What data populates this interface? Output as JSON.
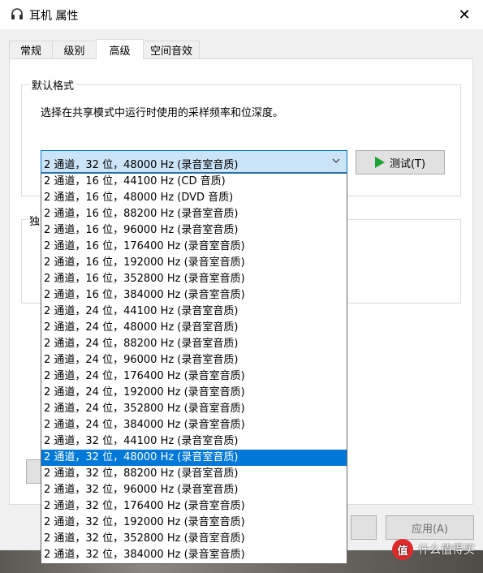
{
  "window": {
    "title": "耳机 属性",
    "close_symbol": "✕"
  },
  "tabs": [
    "常规",
    "级别",
    "高级",
    "空间音效"
  ],
  "default_format": {
    "legend": "默认格式",
    "description": "选择在共享模式中运行时使用的采样频率和位深度。",
    "selected": "2 通道，32 位，48000 Hz (录音室音质)",
    "test_button": "测试(T)"
  },
  "options": [
    "2 通道，16 位，44100 Hz (CD 音质)",
    "2 通道，16 位，48000 Hz (DVD 音质)",
    "2 通道，16 位，88200 Hz (录音室音质)",
    "2 通道，16 位，96000 Hz (录音室音质)",
    "2 通道，16 位，176400 Hz (录音室音质)",
    "2 通道，16 位，192000 Hz (录音室音质)",
    "2 通道，16 位，352800 Hz (录音室音质)",
    "2 通道，16 位，384000 Hz (录音室音质)",
    "2 通道，24 位，44100 Hz (录音室音质)",
    "2 通道，24 位，48000 Hz (录音室音质)",
    "2 通道，24 位，88200 Hz (录音室音质)",
    "2 通道，24 位，96000 Hz (录音室音质)",
    "2 通道，24 位，176400 Hz (录音室音质)",
    "2 通道，24 位，192000 Hz (录音室音质)",
    "2 通道，24 位，352800 Hz (录音室音质)",
    "2 通道，24 位，384000 Hz (录音室音质)",
    "2 通道，32 位，44100 Hz (录音室音质)",
    "2 通道，32 位，48000 Hz (录音室音质)",
    "2 通道，32 位，88200 Hz (录音室音质)",
    "2 通道，32 位，96000 Hz (录音室音质)",
    "2 通道，32 位，176400 Hz (录音室音质)",
    "2 通道，32 位，192000 Hz (录音室音质)",
    "2 通道，32 位，352800 Hz (录音室音质)",
    "2 通道，32 位，384000 Hz (录音室音质)"
  ],
  "selected_index": 17,
  "exclusive_partial": "独",
  "apply_button": "应用(A)",
  "watermark": {
    "badge": "值",
    "text": "什么值得买"
  }
}
